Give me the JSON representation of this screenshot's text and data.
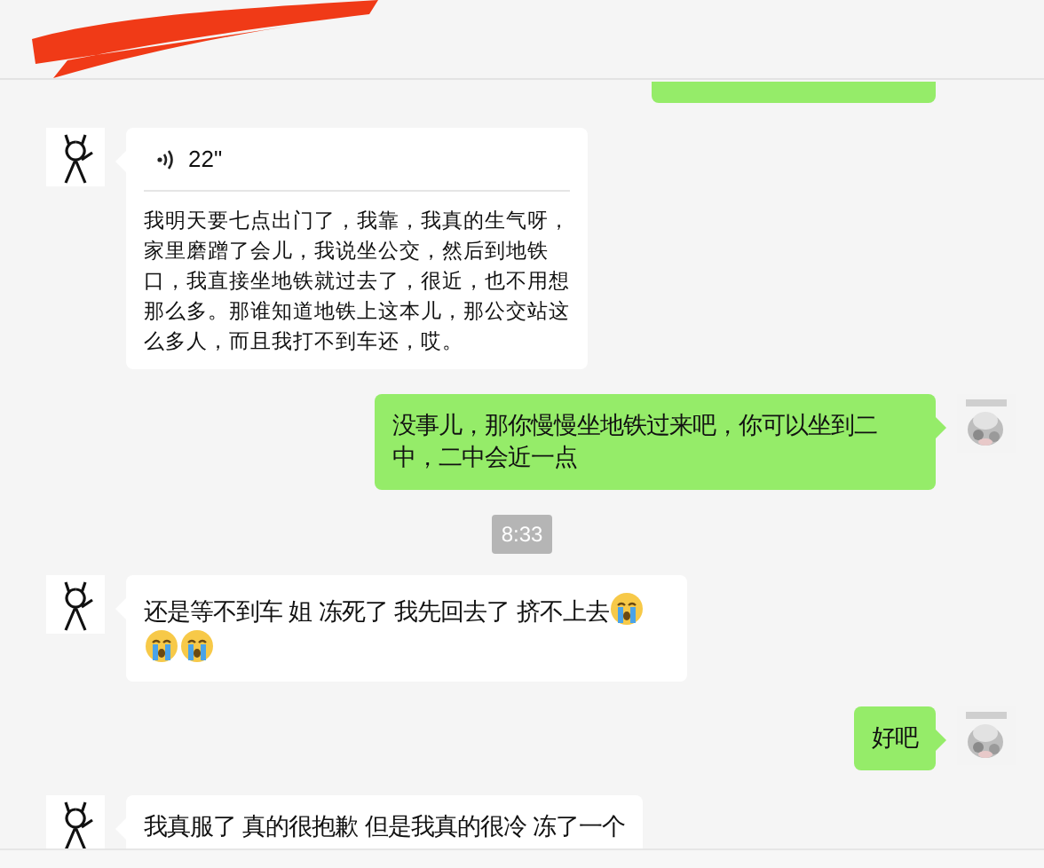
{
  "messages": [
    {
      "kind": "cut",
      "outgoing": true
    },
    {
      "kind": "voice",
      "outgoing": false,
      "duration": "22\"",
      "transcript": "我明天要七点出门了，我靠，我真的生气呀，家里磨蹭了会儿，我说坐公交，然后到地铁口，我直接坐地铁就过去了，很近，也不用想那么多。那谁知道地铁上这本儿，那公交站这么多人，而且我打不到车还，哎。"
    },
    {
      "kind": "text",
      "outgoing": true,
      "parts": [
        {
          "kind": "text",
          "text": "没事儿，那你慢慢坐地铁过来吧，你可以坐到二中，二中会近一点"
        }
      ]
    },
    {
      "kind": "time",
      "text": "8:33"
    },
    {
      "kind": "text",
      "outgoing": false,
      "parts": [
        {
          "kind": "text",
          "text": "还是等不到车 姐 冻死了 我先回去了 挤不上去"
        },
        {
          "kind": "emoji"
        },
        {
          "kind": "emoji"
        },
        {
          "kind": "emoji"
        }
      ]
    },
    {
      "kind": "text",
      "outgoing": true,
      "parts": [
        {
          "kind": "text",
          "text": "好吧"
        }
      ]
    },
    {
      "kind": "text",
      "outgoing": false,
      "parts": [
        {
          "kind": "text",
          "text": "我真服了 真的很抱歉 但是我真的很冷 冻了一个"
        }
      ]
    }
  ]
}
